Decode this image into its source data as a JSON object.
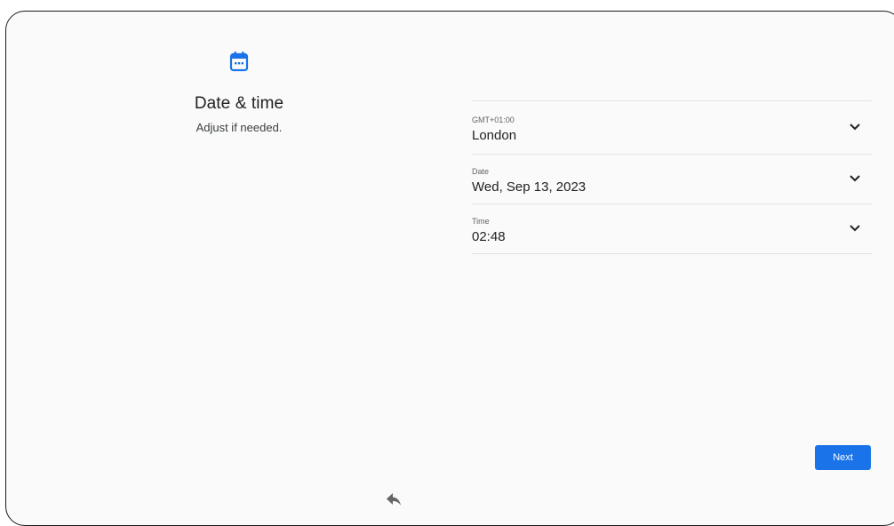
{
  "header": {
    "icon": "calendar-icon",
    "title": "Date & time",
    "subtitle": "Adjust if needed."
  },
  "settings": [
    {
      "label": "GMT+01:00",
      "value": "London"
    },
    {
      "label": "Date",
      "value": "Wed, Sep 13, 2023"
    },
    {
      "label": "Time",
      "value": "02:48"
    }
  ],
  "actions": {
    "next_label": "Next"
  },
  "nav": {
    "back_icon": "back-arrow-icon"
  },
  "colors": {
    "accent": "#1a73e8",
    "background": "#fafafa",
    "divider": "#e3e3e3"
  }
}
